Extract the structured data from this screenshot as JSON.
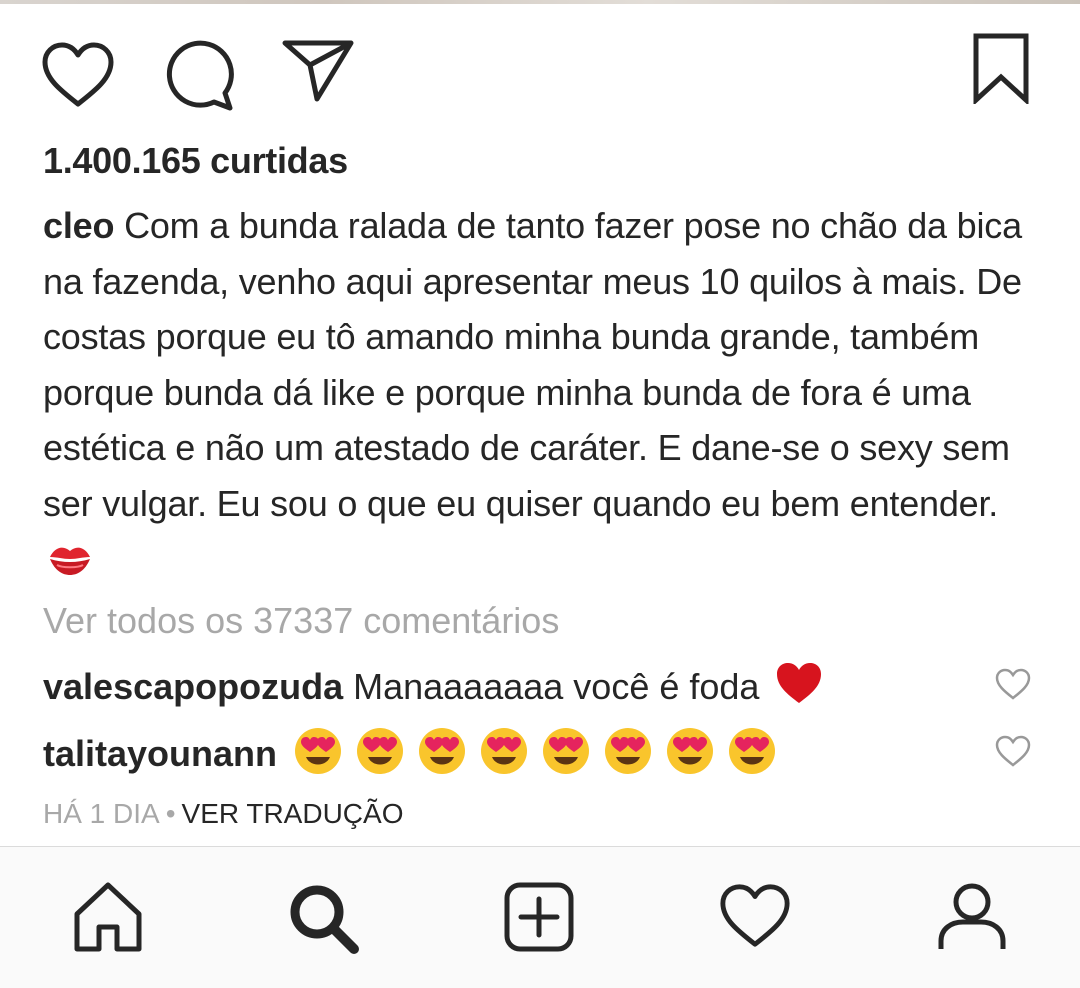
{
  "post": {
    "likes_text": "1.400.165 curtidas",
    "caption_user": "cleo",
    "caption_text": "Com a bunda ralada de tanto fazer pose no chão da bica na fazenda, venho aqui apresentar meus 10 quilos à mais. De costas porque eu tô amando minha bunda grande, também porque bunda dá like e porque minha bunda de fora é uma estética e não um atestado de caráter. E dane-se o sexy sem ser vulgar. Eu sou o que eu quiser quando eu bem entender.",
    "caption_emoji": "kiss-mark-emoji",
    "view_all_comments": "Ver todos os 37337 comentários",
    "comments": [
      {
        "user": "valescapopozuda",
        "text": "Manaaaaaaa você é foda",
        "emoji": "red-heart-emoji"
      },
      {
        "user": "talitayounann",
        "text": "",
        "emoji": "heart-eyes-emoji",
        "emoji_count": 8
      }
    ],
    "timestamp": "HÁ 1 DIA",
    "separator": "•",
    "translate_label": "VER TRADUÇÃO"
  },
  "icons": {
    "like": "heart-outline-icon",
    "comment": "comment-bubble-icon",
    "share": "paper-plane-icon",
    "save": "bookmark-icon",
    "nav": [
      "home-icon",
      "search-icon",
      "new-post-icon",
      "activity-heart-icon",
      "profile-icon"
    ]
  },
  "colors": {
    "text": "#262626",
    "secondary": "#a8a8a8",
    "nav_background": "#fafafa",
    "emoji_red": "#e0242e"
  }
}
